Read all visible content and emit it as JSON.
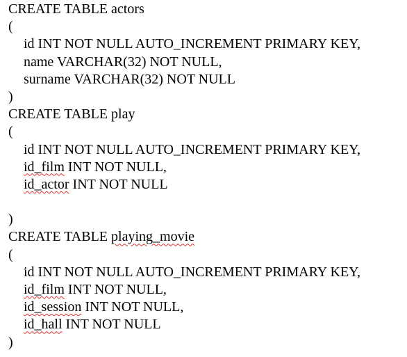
{
  "tables": [
    {
      "header": "CREATE TABLE actors",
      "open": "(",
      "columns": [
        "id INT NOT NULL AUTO_INCREMENT PRIMARY KEY,",
        "name VARCHAR(32) NOT NULL,",
        "surname VARCHAR(32) NOT NULL"
      ],
      "close": ")"
    },
    {
      "header_prefix": "CREATE TABLE ",
      "header_name": "play",
      "open": "(",
      "columns": [
        "id INT NOT NULL AUTO_INCREMENT PRIMARY KEY,",
        {
          "name": "id_film",
          "rest": " INT NOT NULL,"
        },
        {
          "name": "id_actor",
          "rest": " INT NOT NULL"
        }
      ],
      "close": ")"
    },
    {
      "header_prefix": "CREATE TABLE ",
      "header_name": "playing_movie",
      "open": "(",
      "columns": [
        "id INT NOT NULL AUTO_INCREMENT PRIMARY KEY,",
        {
          "name": "id_film",
          "rest": " INT NOT NULL,"
        },
        {
          "name": "id_session",
          "rest": " INT NOT NULL,"
        },
        {
          "name": "id_hall",
          "rest": " INT NOT NULL"
        }
      ],
      "close": ")"
    }
  ]
}
